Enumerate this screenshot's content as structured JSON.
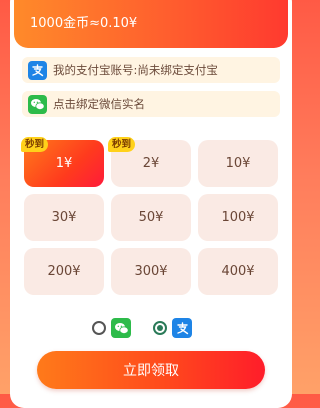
{
  "header": {
    "coin_rate": "1000金币≈0.10¥"
  },
  "accounts": {
    "alipay_text": "我的支付宝账号:尚未绑定支付宝",
    "alipay_icon": "alipay-icon",
    "wechat_text": "点击绑定微信实名",
    "wechat_icon": "wechat-icon"
  },
  "amounts": [
    {
      "label": "1¥",
      "badge": "秒到",
      "selected": true
    },
    {
      "label": "2¥",
      "badge": "秒到",
      "selected": false
    },
    {
      "label": "10¥",
      "badge": "",
      "selected": false
    },
    {
      "label": "30¥",
      "badge": "",
      "selected": false
    },
    {
      "label": "50¥",
      "badge": "",
      "selected": false
    },
    {
      "label": "100¥",
      "badge": "",
      "selected": false
    },
    {
      "label": "200¥",
      "badge": "",
      "selected": false
    },
    {
      "label": "300¥",
      "badge": "",
      "selected": false
    },
    {
      "label": "400¥",
      "badge": "",
      "selected": false
    }
  ],
  "payment": {
    "wechat_selected": false,
    "alipay_selected": true
  },
  "submit_label": "立即领取",
  "colors": {
    "accent": "#ff4a1c",
    "badge": "#ffd11a",
    "alipay": "#1e84e6",
    "wechat": "#2dbb4a"
  }
}
